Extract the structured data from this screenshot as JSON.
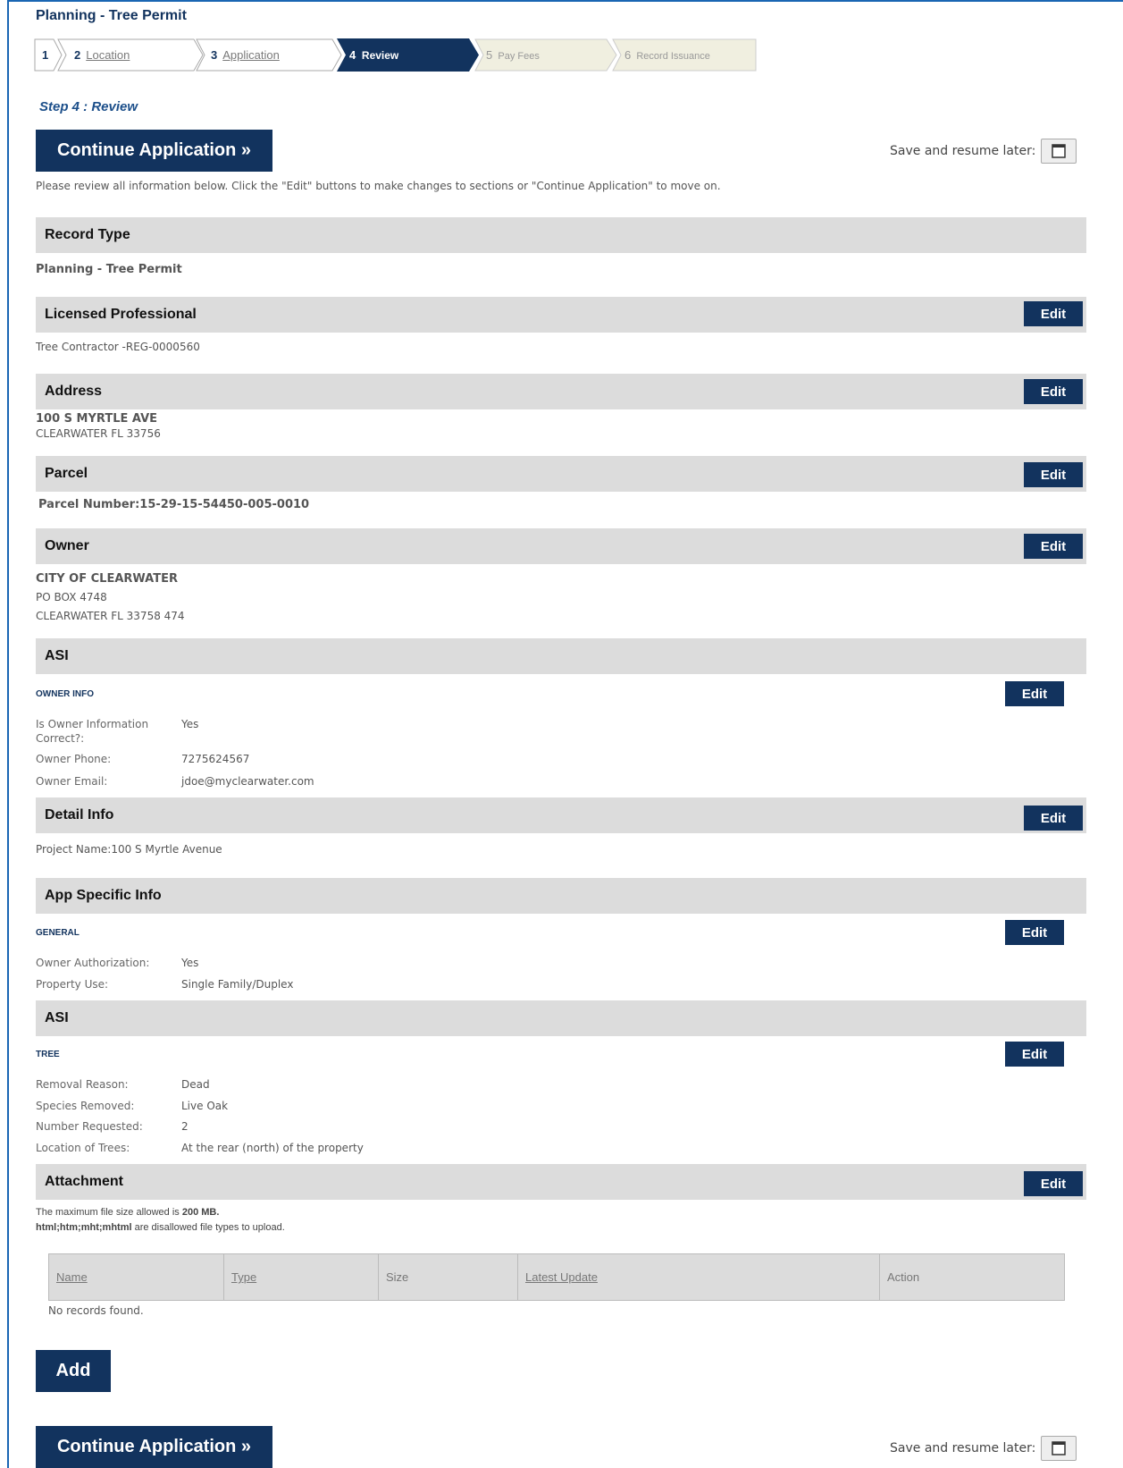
{
  "header": {
    "title": "Planning - Tree Permit"
  },
  "steps": [
    {
      "num": "1",
      "label": ""
    },
    {
      "num": "2",
      "label": "Location"
    },
    {
      "num": "3",
      "label": "Application"
    },
    {
      "num": "4",
      "label": "Review"
    },
    {
      "num": "5",
      "label": "Pay Fees"
    },
    {
      "num": "6",
      "label": "Record Issuance"
    }
  ],
  "step_title": "Step 4 : Review",
  "continue_label": "Continue Application »",
  "save_later_label": "Save and resume later:",
  "instructions": "Please review all information below. Click the \"Edit\" buttons to make changes to sections or \"Continue Application\" to move on.",
  "edit_label": "Edit",
  "sections": {
    "record_type": {
      "title": "Record Type",
      "value": "Planning - Tree Permit"
    },
    "licensed_professional": {
      "title": "Licensed Professional",
      "value": "Tree Contractor -REG-0000560"
    },
    "address": {
      "title": "Address",
      "line1": "100 S MYRTLE AVE",
      "line2": "CLEARWATER FL 33756"
    },
    "parcel": {
      "title": "Parcel",
      "value": "Parcel Number:15-29-15-54450-005-0010"
    },
    "owner": {
      "title": "Owner",
      "name": "CITY OF CLEARWATER",
      "line2": "PO BOX 4748",
      "line3": "CLEARWATER FL 33758 474"
    },
    "asi_owner": {
      "title": "ASI",
      "subhead": "OWNER INFO",
      "fields": [
        {
          "label": "Is Owner Information",
          "label2": "Correct?:",
          "value": "Yes"
        },
        {
          "label": "Owner Phone:",
          "value": "7275624567"
        },
        {
          "label": "Owner Email:",
          "value": "jdoe@myclearwater.com"
        }
      ]
    },
    "detail_info": {
      "title": "Detail Info",
      "value": "Project Name:100 S Myrtle Avenue"
    },
    "app_specific": {
      "title": "App Specific Info",
      "subhead": "GENERAL",
      "fields": [
        {
          "label": "Owner Authorization:",
          "value": "Yes"
        },
        {
          "label": "Property Use:",
          "value": "Single Family/Duplex"
        }
      ]
    },
    "asi_tree": {
      "title": "ASI",
      "subhead": "TREE",
      "fields": [
        {
          "label": "Removal Reason:",
          "value": "Dead"
        },
        {
          "label": "Species Removed:",
          "value": "Live Oak"
        },
        {
          "label": "Number Requested:",
          "value": "2"
        },
        {
          "label": "Location of Trees:",
          "value": "At the rear (north) of the property"
        }
      ]
    },
    "attachment": {
      "title": "Attachment",
      "max_size_prefix": "The maximum file size allowed is ",
      "max_size_value": "200 MB.",
      "disallowed_types": "html;htm;mht;mhtml",
      "disallowed_suffix": " are disallowed file types to upload.",
      "columns": [
        "Name",
        "Type",
        "Size",
        "Latest Update",
        "Action"
      ],
      "empty_text": "No records found.",
      "add_label": "Add"
    }
  },
  "colors": {
    "primary": "#12335e",
    "section_bar": "#dcdcdc",
    "future_step": "#f0efe0",
    "frame": "#1a66b3"
  }
}
